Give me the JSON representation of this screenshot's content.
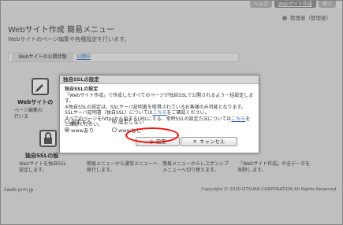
{
  "topnav": {
    "items": [
      "ヘルプ",
      "Webサイト作成",
      "終了"
    ],
    "active_index": 1
  },
  "user": {
    "label": "管理者（管理者）"
  },
  "page": {
    "title": "Webサイト作成 簡易メニュー",
    "subtitle": "Webサイトのページ編集や各種設定を行います。"
  },
  "tabs": [
    {
      "label": "Webサイトの公開状態"
    },
    {
      "label": "公開中"
    }
  ],
  "tiles": [
    {
      "title": "Webサイトの",
      "text": "ページ編集の\n行いま"
    },
    {
      "title": "独自SSLの設",
      "text": "Webサイトを独自SSL\n設定します。"
    }
  ],
  "bottom_texts": [
    "簡易メニューから通常メニューへ\n移行します。",
    "簡易メニューからレスポンシブ\nメニューへ切り替えます。",
    "「Webサイト作成」の全データを\n削除します。"
  ],
  "footer": {
    "left": "iiweb-prm.jp",
    "right": "Copyright © 2020 OTSUKA CORPORATION All Rights Reserved."
  },
  "dialog": {
    "title": "独自SSLの設定",
    "heading": "独自SSLの設定",
    "line1": "「Webサイト作成」で作成したすべてのページが独自SSLで公開されるよう一括設定します。",
    "line2": "※独自SSLの設定は、SSLサーバ証明書を取得されているお客様のみ可能となります。",
    "line3a": "SSLサーバ証明書（独自SSL）については",
    "line3_link": "こちら",
    "line3b": "をご確認ください。",
    "line4a": "すべてのページをhttpsから始まるURLにする、常時SSLの設定方法については",
    "line4_link": "こちら",
    "line4b": "をご確認ください。",
    "options_row1": [
      {
        "label": "設定する",
        "selected": false
      },
      {
        "label": "設定しない",
        "selected": true
      }
    ],
    "options_row2": [
      {
        "label": "wwwあり",
        "selected": true
      },
      {
        "label": "wwwなし",
        "selected": false
      }
    ],
    "ok_label": "設定",
    "cancel_label": "キャンセル"
  },
  "colors": {
    "highlight": "#ee1111",
    "link": "#2a5fb0"
  },
  "icons": [
    "user-icon",
    "edit-icon",
    "lock-icon",
    "settings-circle-icon",
    "close-x-icon"
  ]
}
